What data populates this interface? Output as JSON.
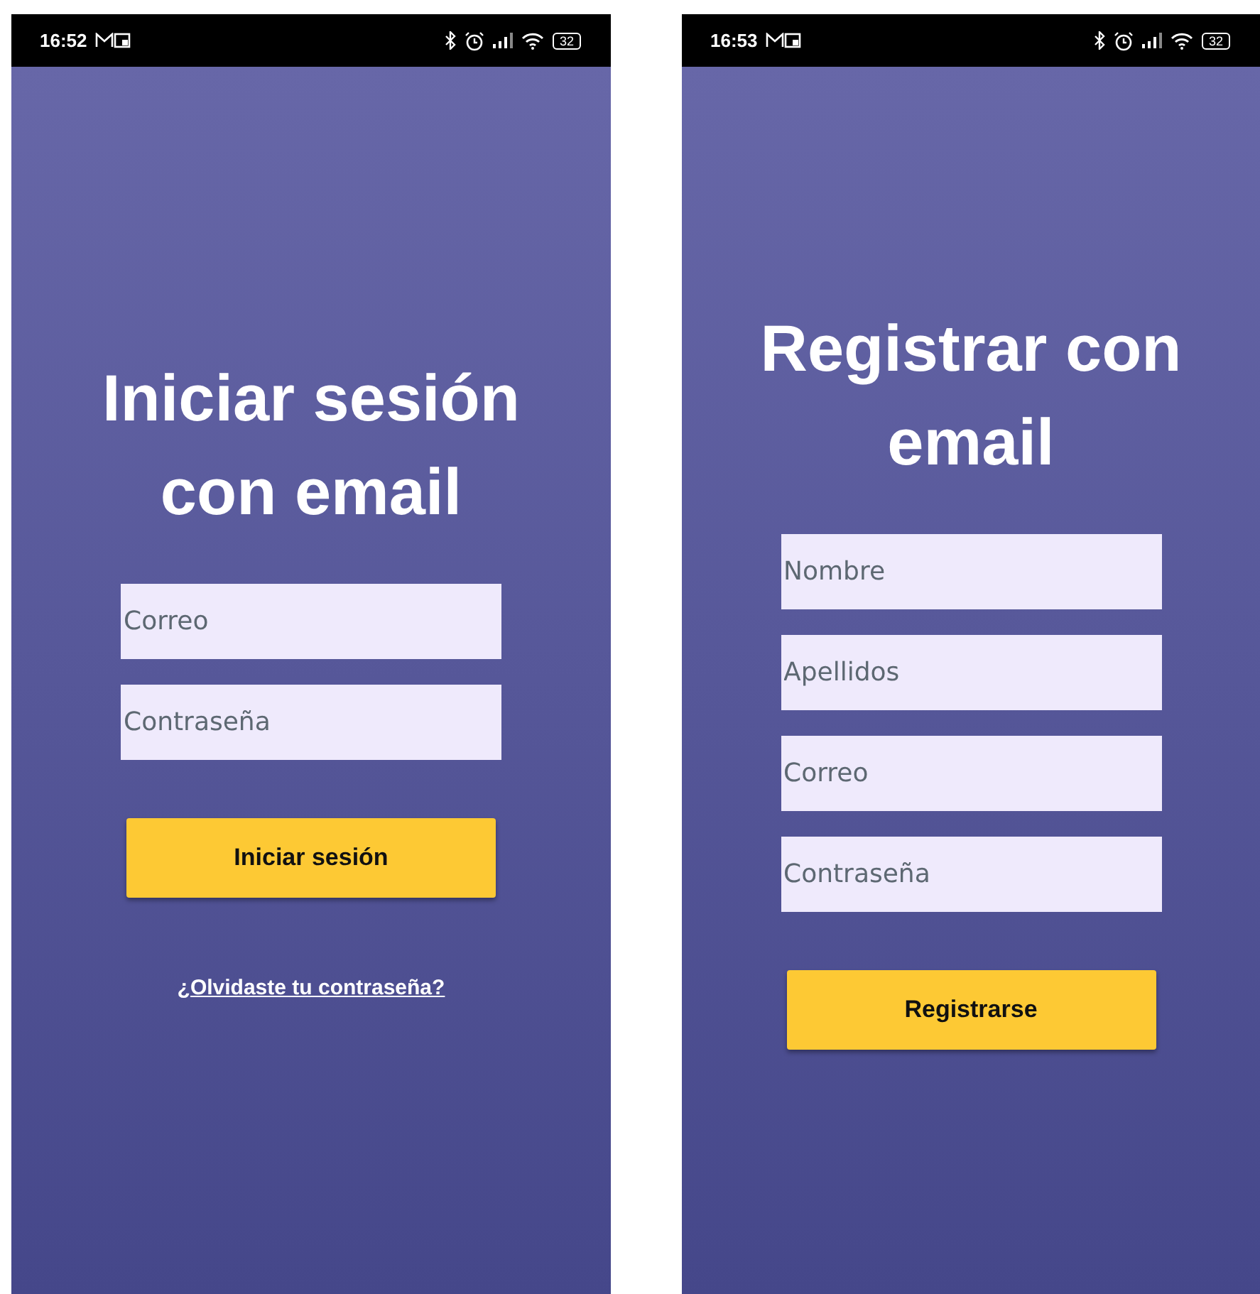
{
  "screens": [
    {
      "status_bar": {
        "time": "16:52",
        "battery": "32"
      },
      "title": "Iniciar sesión con email",
      "fields": [
        {
          "placeholder": "Correo"
        },
        {
          "placeholder": "Contraseña"
        }
      ],
      "button": "Iniciar sesión",
      "link": "¿Olvidaste tu contraseña?"
    },
    {
      "status_bar": {
        "time": "16:53",
        "battery": "32"
      },
      "title": "Registrar con email",
      "fields": [
        {
          "placeholder": "Nombre"
        },
        {
          "placeholder": "Apellidos"
        },
        {
          "placeholder": "Correo"
        },
        {
          "placeholder": "Contraseña"
        }
      ],
      "button": "Registrarse"
    }
  ]
}
